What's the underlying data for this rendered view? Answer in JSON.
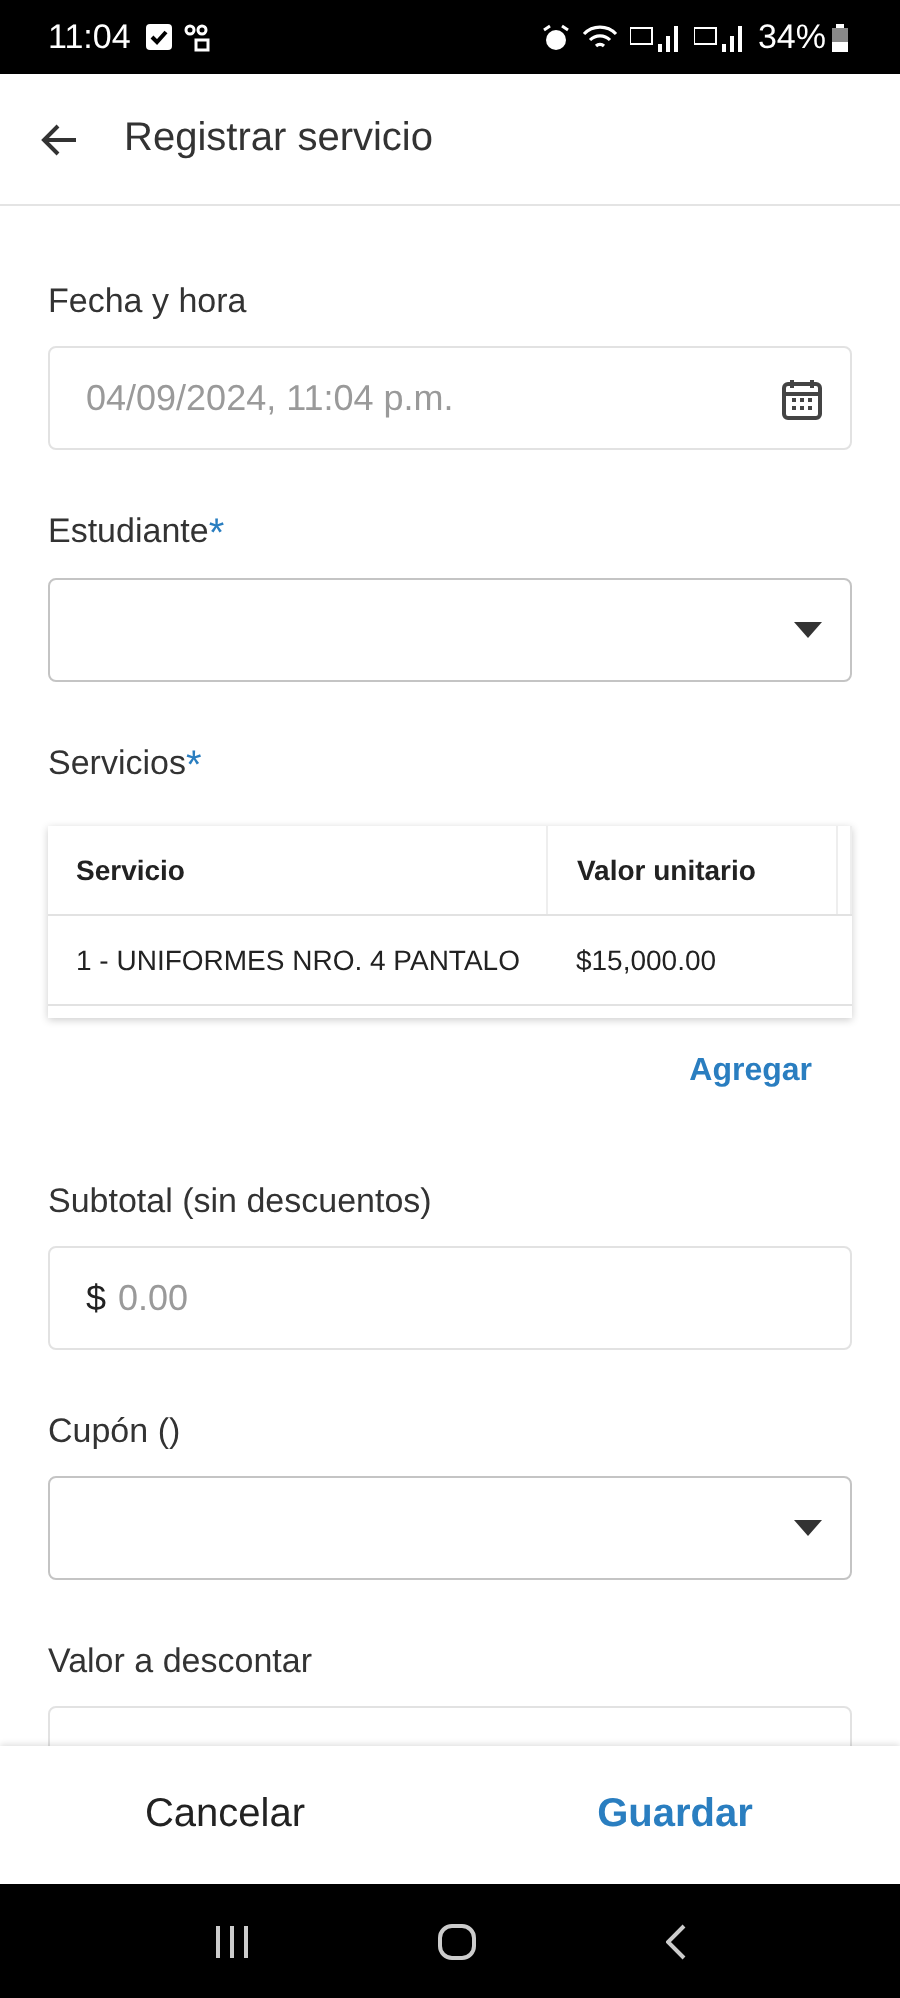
{
  "status_bar": {
    "time": "11:04",
    "battery": "34%"
  },
  "app_bar": {
    "title": "Registrar servicio"
  },
  "fields": [
    {
      "kind": "date",
      "label": "Fecha y hora",
      "placeholder": "04/09/2024, 11:04 p.m."
    },
    {
      "kind": "select",
      "label": "Estudiante",
      "required_mark": "*"
    },
    {
      "kind": "table",
      "label": "Servicios",
      "required_mark": "*",
      "columns": [
        "Servicio",
        "Valor unitario"
      ],
      "rows": [
        [
          "1 - UNIFORMES NRO. 4 PANTALO",
          "$15,000.00"
        ]
      ],
      "action": "Agregar"
    },
    {
      "kind": "money",
      "label": "Subtotal (sin descuentos)",
      "prefix": "$",
      "placeholder": "0.00"
    },
    {
      "kind": "select",
      "label": "Cupón ()"
    },
    {
      "kind": "money",
      "label": "Valor a descontar"
    }
  ],
  "actions": [
    {
      "label": "Cancelar",
      "primary": false
    },
    {
      "label": "Guardar",
      "primary": true
    }
  ]
}
